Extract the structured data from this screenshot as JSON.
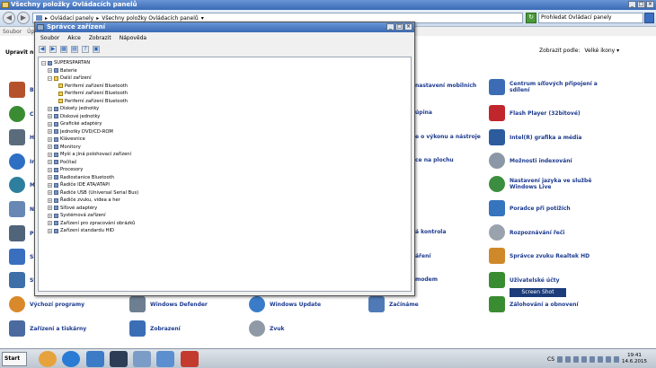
{
  "window": {
    "title": "Všechny položky Ovládacích panelů"
  },
  "address": {
    "crumbs": [
      "Ovládací panely",
      "Všechny položky Ovládacích panelů"
    ],
    "search_placeholder": "Prohledat Ovládací panely"
  },
  "menubar": {
    "items": [
      "Soubor",
      "Úp"
    ]
  },
  "heading": "Upravit n",
  "viewby": {
    "label": "Zobrazit podle:",
    "value": "Velké ikony"
  },
  "cp_items": [
    {
      "label": "Bi",
      "icon": "#b5522b"
    },
    {
      "label": "C",
      "icon": "#3a8c32"
    },
    {
      "label": "H",
      "icon": "#5a6b7c"
    },
    {
      "label": "Ir",
      "icon": "#2d6fc2"
    },
    {
      "label": "M",
      "icon": "#2d7f9d"
    },
    {
      "label": "N",
      "icon": "#6788b4"
    },
    {
      "label": "P",
      "icon": "#50647a"
    },
    {
      "label": "Sl",
      "icon": "#3a6fc0"
    },
    {
      "label": "Sy",
      "icon": "#3f6fa8"
    },
    {
      "label": "nastavení mobilních"
    },
    {
      "label": "úpina"
    },
    {
      "label": "e o výkonu a nástroje"
    },
    {
      "label": "ce na plochu"
    },
    {
      "label": "á kontrola"
    },
    {
      "label": "áření"
    },
    {
      "label": "modem"
    },
    {
      "label": "Centrum síťových připojení a sdílení",
      "icon": "#3c6cb5"
    },
    {
      "label": "Flash Player (32bitové)",
      "icon": "#c0262b"
    },
    {
      "label": "Intel(R) grafika a média",
      "icon": "#2d5c9e"
    },
    {
      "label": "Možnosti indexování",
      "icon": "#8b97a6"
    },
    {
      "label": "Nastavení jazyka ve službě Windows Live",
      "icon": "#3b8e3f"
    },
    {
      "label": "Poradce při potížích",
      "icon": "#3674be"
    },
    {
      "label": "Rozpoznávání řeči",
      "icon": "#9aa3ad"
    },
    {
      "label": "Správce zvuku Realtek HD",
      "icon": "#d0892a"
    },
    {
      "label": "Uživatelské účty",
      "icon": "#3a8c32"
    },
    {
      "label": "Zálohování a obnovení",
      "icon": "#3a8c32"
    },
    {
      "label": "Výchozí programy",
      "icon": "#d9882b"
    },
    {
      "label": "Windows Defender",
      "icon": "#6e7f92"
    },
    {
      "label": "Windows Update",
      "icon": "#3b7cc9"
    },
    {
      "label": "Začínáme",
      "icon": "#4f7ab6"
    },
    {
      "label": "Zařízení a tiskárny",
      "icon": "#4a6aa0"
    },
    {
      "label": "Zobrazení",
      "icon": "#3b6fb5"
    },
    {
      "label": "Zvuk",
      "icon": "#8f9aa6"
    }
  ],
  "tooltip": "Screen Shot",
  "device_manager": {
    "title": "Správce zařízení",
    "menu": [
      "Soubor",
      "Akce",
      "Zobrazit",
      "Nápověda"
    ],
    "tree": [
      {
        "label": "SUPERSPARTAN",
        "exp": "−",
        "warn": false
      },
      {
        "label": "Baterie",
        "exp": "+",
        "warn": false
      },
      {
        "label": "Další zařízení",
        "exp": "−",
        "warn": true
      },
      {
        "label": "Periferní zařízení Bluetooth",
        "exp": "",
        "warn": true
      },
      {
        "label": "Periferní zařízení Bluetooth",
        "exp": "",
        "warn": true
      },
      {
        "label": "Periferní zařízení Bluetooth",
        "exp": "",
        "warn": true
      },
      {
        "label": "Diskety jednotky",
        "exp": "+",
        "warn": false
      },
      {
        "label": "Diskové jednotky",
        "exp": "+",
        "warn": false
      },
      {
        "label": "Grafické adaptéry",
        "exp": "+",
        "warn": false
      },
      {
        "label": "Jednotky DVD/CD-ROM",
        "exp": "+",
        "warn": false
      },
      {
        "label": "Klávesnice",
        "exp": "+",
        "warn": false
      },
      {
        "label": "Monitory",
        "exp": "+",
        "warn": false
      },
      {
        "label": "Myši a jiná polohovací zařízení",
        "exp": "+",
        "warn": false
      },
      {
        "label": "Počítač",
        "exp": "+",
        "warn": false
      },
      {
        "label": "Procesory",
        "exp": "+",
        "warn": false
      },
      {
        "label": "Radiostanice Bluetooth",
        "exp": "+",
        "warn": false
      },
      {
        "label": "Řadiče IDE ATA/ATAPI",
        "exp": "+",
        "warn": false
      },
      {
        "label": "Řadiče USB (Universal Serial Bus)",
        "exp": "+",
        "warn": false
      },
      {
        "label": "Řadiče zvuku, videa a her",
        "exp": "+",
        "warn": false
      },
      {
        "label": "Síťové adaptéry",
        "exp": "+",
        "warn": false
      },
      {
        "label": "Systémová zařízení",
        "exp": "+",
        "warn": false
      },
      {
        "label": "Zařízení pro zpracování obrázků",
        "exp": "+",
        "warn": false
      },
      {
        "label": "Zařízení standardu HID",
        "exp": "+",
        "warn": false
      }
    ]
  },
  "taskbar": {
    "start_label": "Start",
    "apps": [
      "#e6a23c",
      "#2a7bd4",
      "#3c7bc6",
      "#2c3d55",
      "#7a9cc7",
      "#5b8fcf",
      "#c23b2e"
    ],
    "lang": "CS",
    "time": "19:41",
    "date": "14.6.2015"
  }
}
